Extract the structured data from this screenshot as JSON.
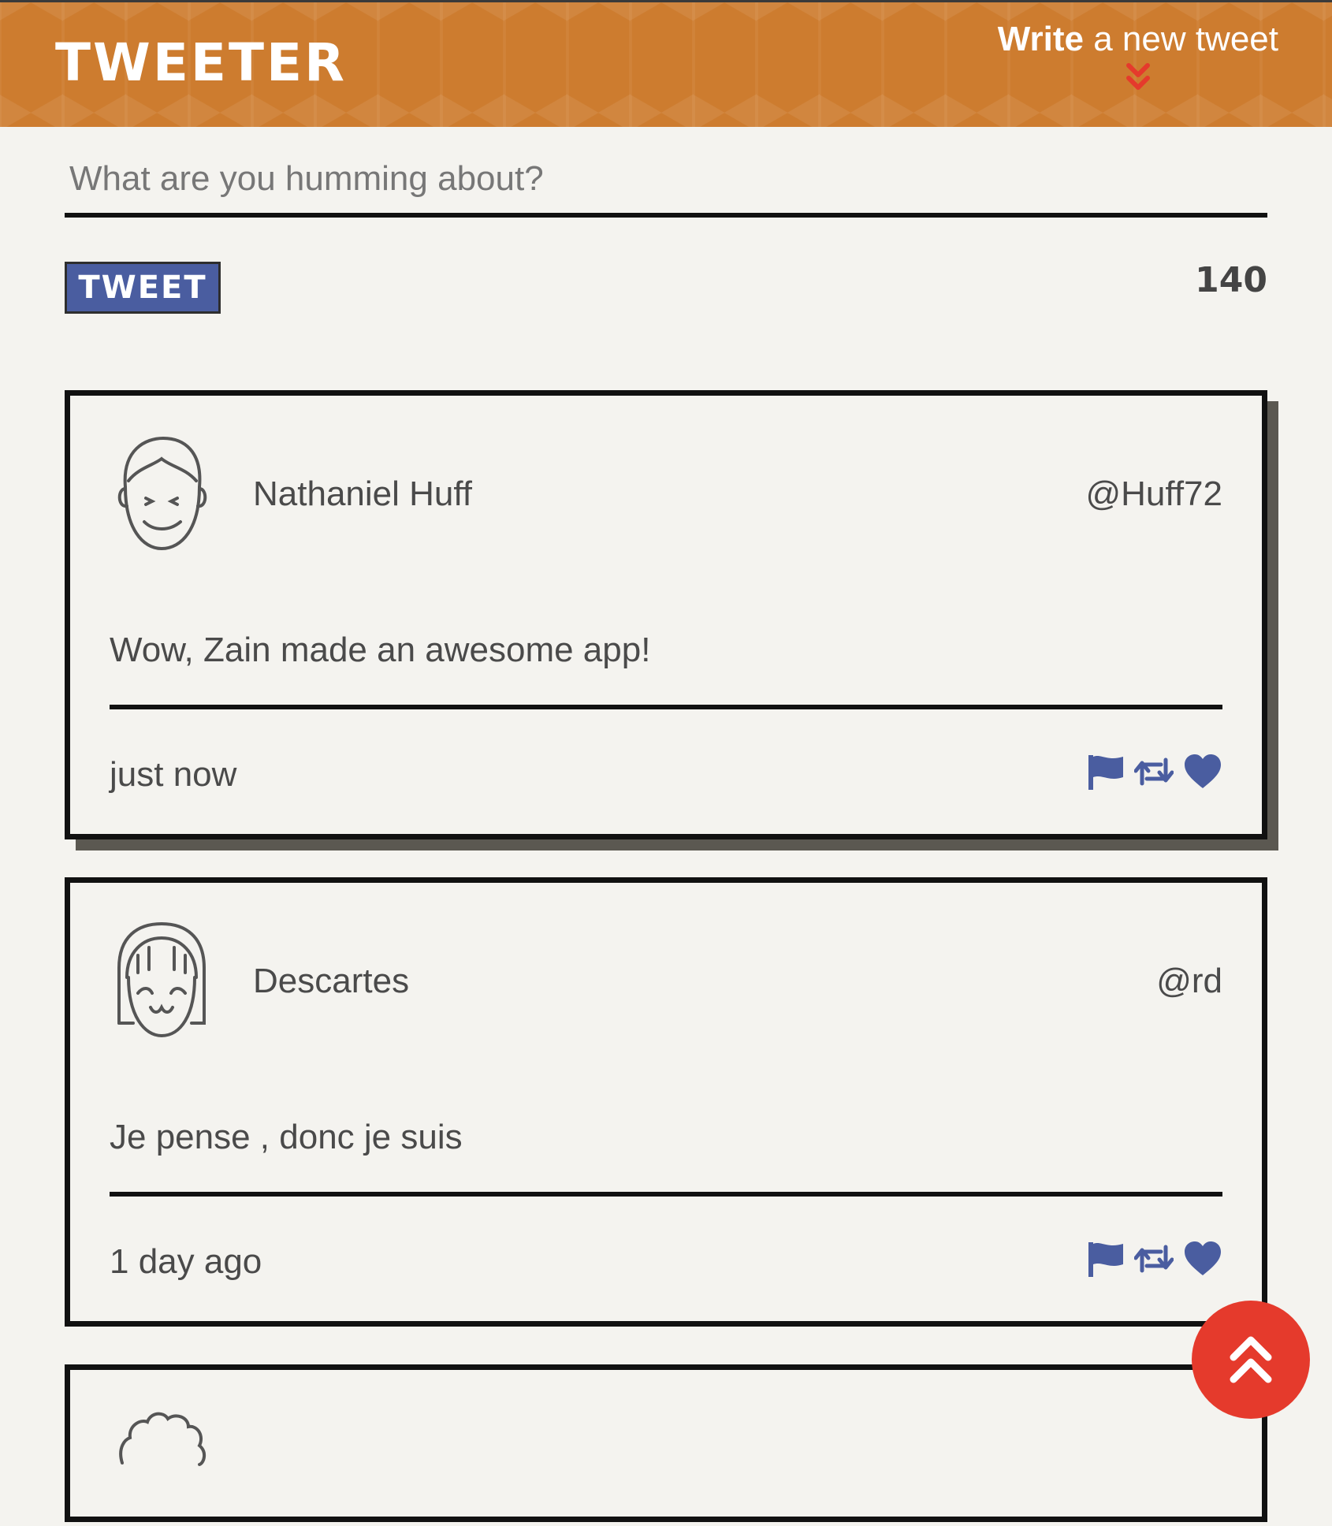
{
  "header": {
    "brand": "Tweeter",
    "compose_strong": "Write",
    "compose_rest": " a new tweet",
    "chevron_icon": "double-chevron-down-icon"
  },
  "composer": {
    "placeholder": "What are you humming about?",
    "value": "",
    "submit_label": "Tweet",
    "char_count": "140"
  },
  "tweets": [
    {
      "name": "Nathaniel Huff",
      "handle": "@Huff72",
      "text": "Wow, Zain made an awesome app!",
      "time": "just now",
      "avatar_icon": "male-face-avatar-icon"
    },
    {
      "name": "Descartes",
      "handle": "@rd",
      "text": "Je pense , donc je suis",
      "time": "1 day ago",
      "avatar_icon": "female-face-avatar-icon"
    }
  ],
  "action_icons": [
    "flag-icon",
    "retweet-icon",
    "heart-icon"
  ],
  "colors": {
    "header_bg": "#cd7c2f",
    "accent_blue": "#4a5da0",
    "scroll_button": "#e53a2c",
    "chevron_red": "#e53a2c",
    "page_bg": "#f4f3ef"
  }
}
